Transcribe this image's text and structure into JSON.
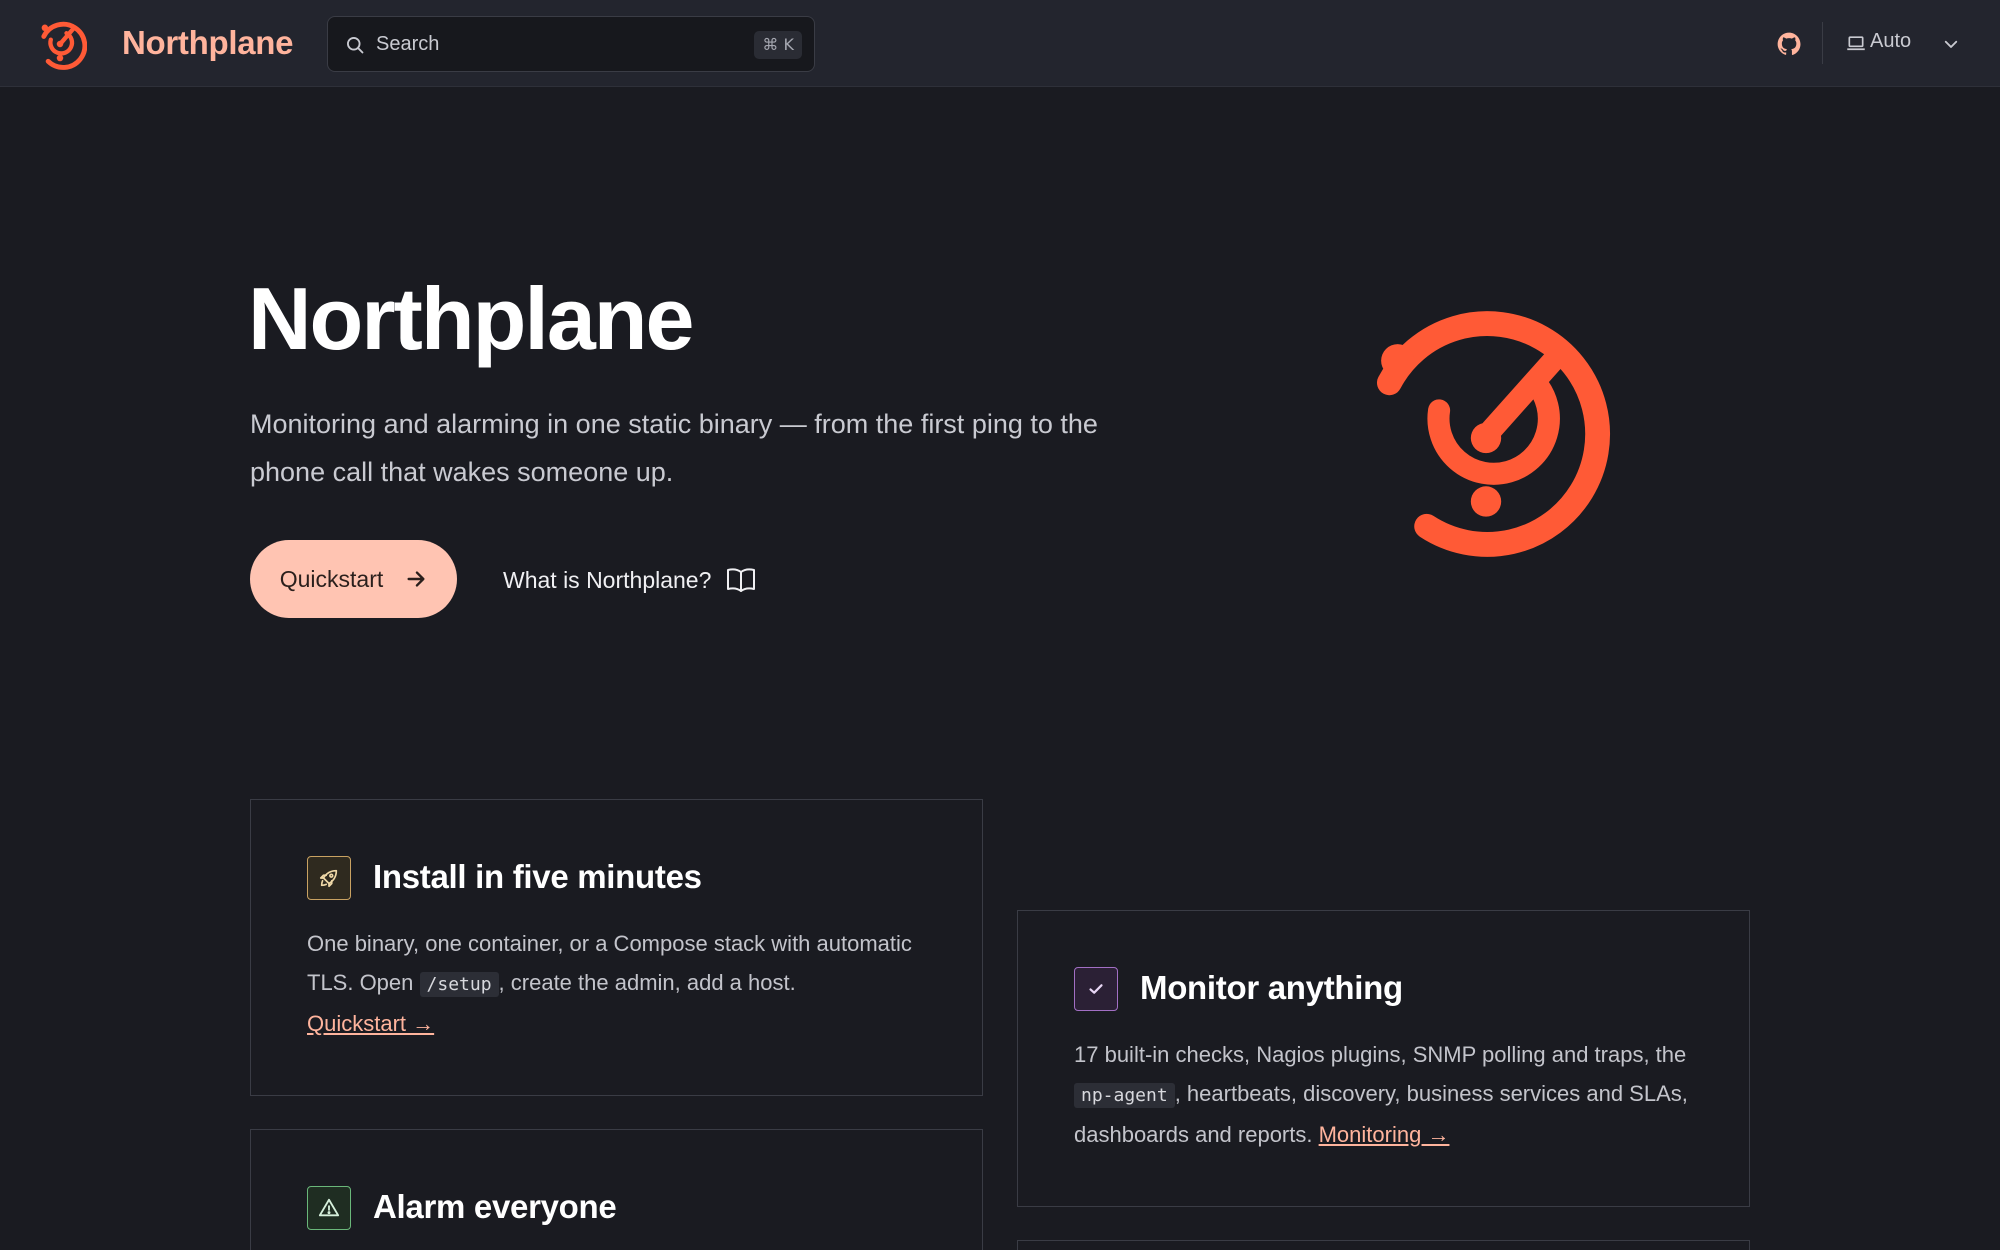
{
  "header": {
    "brand": "Northplane",
    "search_label": "Search",
    "search_shortcut": "⌘ K",
    "theme_label": "Auto",
    "icons": [
      "radar-logo-icon",
      "search-icon",
      "github-icon",
      "laptop-icon",
      "chevron-down-icon"
    ]
  },
  "hero": {
    "title": "Northplane",
    "subtitle": "Monitoring and alarming in one static binary — from the first ping to the phone call that wakes someone up.",
    "primary_cta": "Quickstart",
    "secondary_cta": "What is Northplane?"
  },
  "cards": {
    "install": {
      "title": "Install in five minutes",
      "text_before": "One binary, one container, or a Compose stack with automatic TLS. Open ",
      "code": "/setup",
      "text_after": ", create the admin, add a host. ",
      "link": "Quickstart →",
      "icon": "rocket-icon"
    },
    "monitor": {
      "title": "Monitor anything",
      "text_before": "17 built-in checks, Nagios plugins, SNMP polling and traps, the ",
      "code": "np-agent",
      "text_after": ", heartbeats, discovery, business services and SLAs, dashboards and reports. ",
      "link": "Monitoring →",
      "icon": "check-icon"
    },
    "alarm": {
      "title": "Alarm everyone",
      "icon": "warning-icon"
    }
  },
  "colors": {
    "accent": "#ff5a36",
    "accent_soft": "#ffc4b2",
    "brand_text": "#ffb49d",
    "background": "#1a1b21",
    "header_bg": "#23252e"
  }
}
